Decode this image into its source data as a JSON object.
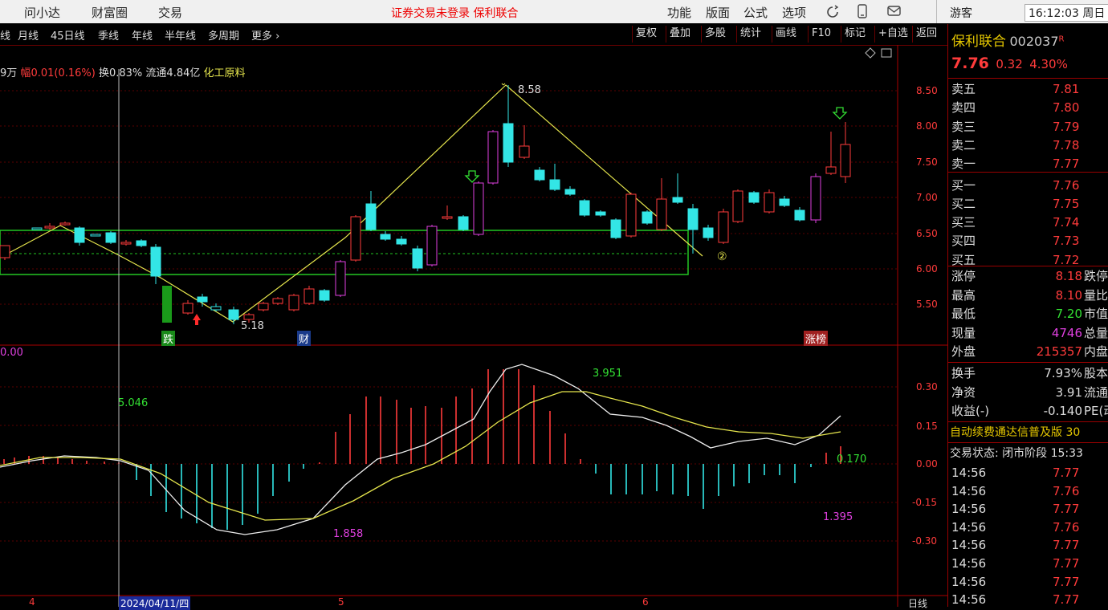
{
  "menubar": {
    "items": [
      "问小达",
      "财富圈",
      "交易"
    ],
    "notice": "证券交易未登录  保利联合",
    "right_items": [
      "功能",
      "版面",
      "公式",
      "选项"
    ],
    "user": "游客",
    "clock": "16:12:03 周日"
  },
  "toolbar": {
    "periods": [
      "线",
      "月线",
      "45日线",
      "季线",
      "年线",
      "半年线",
      "多周期",
      "更多 ›"
    ],
    "buttons": [
      "复权",
      "叠加",
      "多股",
      "统计",
      "画线",
      "F10",
      "标记",
      "+自选",
      "返回"
    ]
  },
  "chart_info": {
    "vol": "9万",
    "amp_label": "幅",
    "amp": "0.01(0.16%)",
    "turnover": "换0.83%",
    "float": "流通4.84亿",
    "industry": "化工原料"
  },
  "price_axis": [
    "8.50",
    "8.00",
    "7.50",
    "7.00",
    "6.50",
    "6.00",
    "5.50"
  ],
  "macd_axis": [
    "0.30",
    "0.15",
    "0.00",
    "-0.15",
    "-0.30"
  ],
  "chart_annotations": {
    "high_mark": "8.58",
    "low_mark": "5.18",
    "circle_num": "②",
    "tag_fall": "跌",
    "tag_fin": "财",
    "tag_rank": "涨榜",
    "macd_left": "0.00",
    "macd_a": "5.046",
    "macd_b": "3.951",
    "macd_c": "1.858",
    "macd_d": "0.170",
    "macd_e": "1.395"
  },
  "date_axis": {
    "m4": "4",
    "cursor_date": "2024/04/11/四",
    "m5": "5",
    "m6": "6",
    "corner": "日线"
  },
  "stock": {
    "name": "保利联合",
    "code": "002037",
    "badge": "R",
    "price": "7.76",
    "change": "0.32",
    "pct": "4.30%"
  },
  "order_book": [
    {
      "label": "卖五",
      "price": "7.81"
    },
    {
      "label": "卖四",
      "price": "7.80"
    },
    {
      "label": "卖三",
      "price": "7.79"
    },
    {
      "label": "卖二",
      "price": "7.78"
    },
    {
      "label": "卖一",
      "price": "7.77"
    },
    {
      "label": "买一",
      "price": "7.76"
    },
    {
      "label": "买二",
      "price": "7.75"
    },
    {
      "label": "买三",
      "price": "7.74"
    },
    {
      "label": "买四",
      "price": "7.73"
    },
    {
      "label": "买五",
      "price": "7.72"
    }
  ],
  "stats": [
    {
      "label": "涨停",
      "value": "8.18",
      "color": "#ff3b3b",
      "extra": "跌停"
    },
    {
      "label": "最高",
      "value": "8.10",
      "color": "#ff3b3b",
      "extra": "量比"
    },
    {
      "label": "最低",
      "value": "7.20",
      "color": "#33e033",
      "extra": "市值"
    },
    {
      "label": "现量",
      "value": "4746",
      "color": "#e040e0",
      "extra": "总量"
    },
    {
      "label": "外盘",
      "value": "215357",
      "color": "#ff3b3b",
      "extra": "内盘"
    }
  ],
  "fundamentals": [
    {
      "label": "换手",
      "value": "7.93%",
      "extra": "股本"
    },
    {
      "label": "净资",
      "value": "3.91",
      "extra": "流通"
    },
    {
      "label": "收益(-)",
      "value": "-0.140",
      "extra": "PE(动"
    }
  ],
  "ad_banner": "自动续费通达信普及版 30",
  "trade_status": "交易状态: 闭市阶段 15:33",
  "ticks": [
    {
      "time": "14:56",
      "price": "7.77"
    },
    {
      "time": "14:56",
      "price": "7.76"
    },
    {
      "time": "14:56",
      "price": "7.77"
    },
    {
      "time": "14:56",
      "price": "7.76"
    },
    {
      "time": "14:56",
      "price": "7.77"
    },
    {
      "time": "14:56",
      "price": "7.77"
    },
    {
      "time": "14:56",
      "price": "7.77"
    },
    {
      "time": "14:56",
      "price": "7.77"
    }
  ],
  "colors": {
    "up": "#ff3b3b",
    "down": "#33e6e6",
    "bull_box": "#e040e0",
    "zigzag": "#e6e64d",
    "box": "#22c522"
  }
}
